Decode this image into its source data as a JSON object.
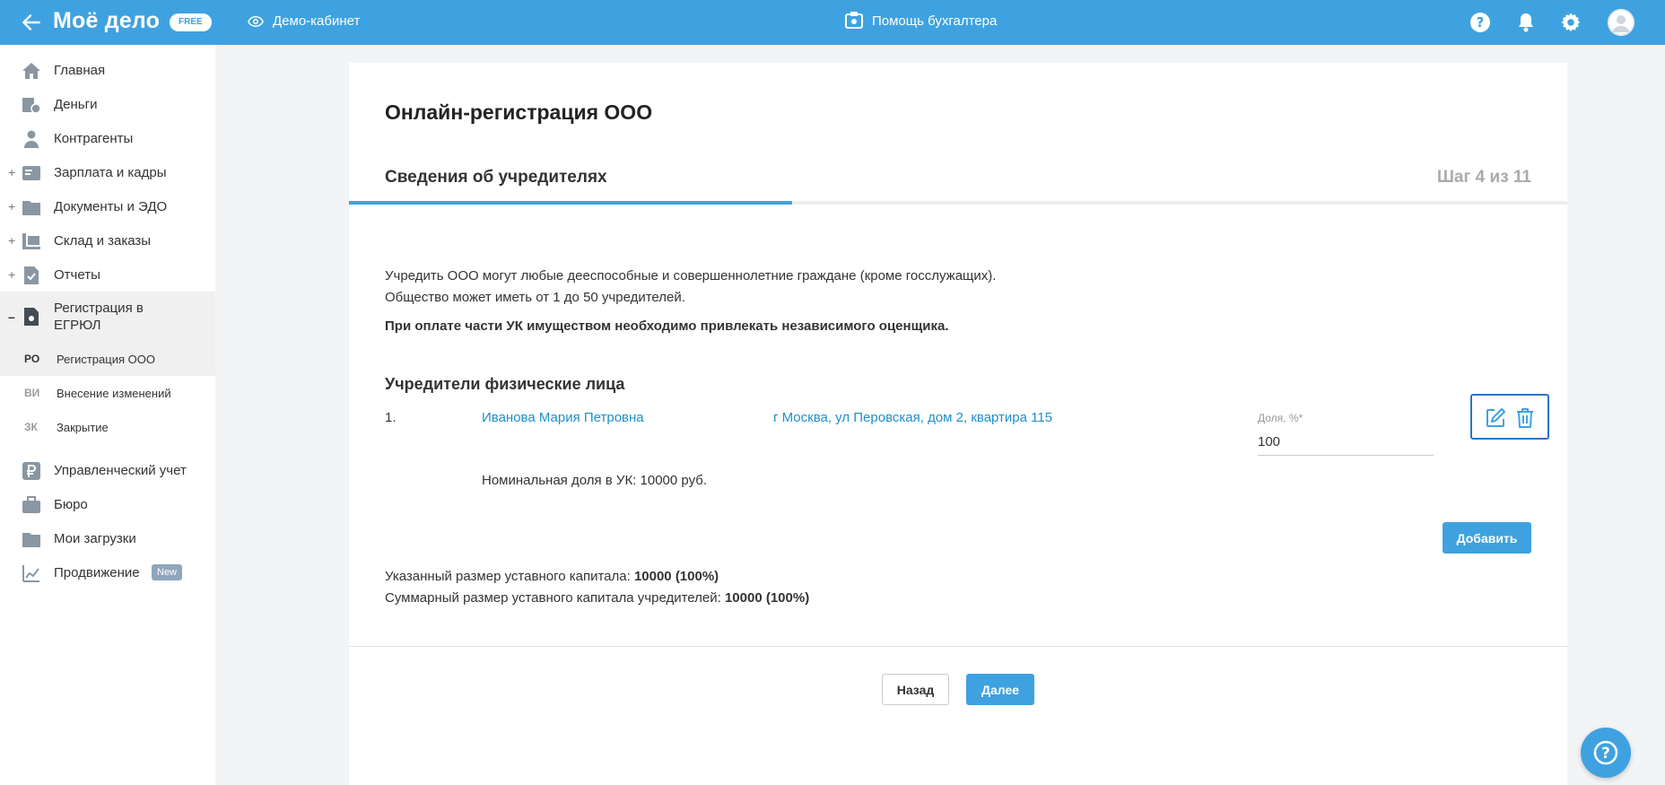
{
  "header": {
    "logo": "Моё дело",
    "badge": "FREE",
    "demo_label": "Демо-кабинет",
    "helper_label": "Помощь бухгалтера"
  },
  "sidebar": {
    "items": [
      {
        "label": "Главная",
        "icon": "home-icon"
      },
      {
        "label": "Деньги",
        "icon": "money-icon"
      },
      {
        "label": "Контрагенты",
        "icon": "contractors-icon"
      },
      {
        "label": "Зарплата и кадры",
        "icon": "salary-icon",
        "expand": "+"
      },
      {
        "label": "Документы и ЭДО",
        "icon": "documents-icon",
        "expand": "+"
      },
      {
        "label": "Склад и заказы",
        "icon": "warehouse-icon",
        "expand": "+"
      },
      {
        "label": "Отчеты",
        "icon": "reports-icon",
        "expand": "+"
      },
      {
        "label": "Регистрация в ЕГРЮЛ",
        "icon": "registration-icon",
        "expand": "–"
      },
      {
        "label": "Управленческий учет",
        "icon": "ruble-icon"
      },
      {
        "label": "Бюро",
        "icon": "briefcase-icon"
      },
      {
        "label": "Мои загрузки",
        "icon": "folder-icon"
      },
      {
        "label": "Продвижение",
        "icon": "chart-icon",
        "badge": "New"
      }
    ],
    "sub_items": [
      {
        "abbr": "РО",
        "label": "Регистрация ООО"
      },
      {
        "abbr": "ВИ",
        "label": "Внесение изменений"
      },
      {
        "abbr": "ЗК",
        "label": "Закрытие"
      }
    ]
  },
  "main": {
    "title": "Онлайн-регистрация ООО",
    "step_name": "Сведения об учредителях",
    "step_count": "Шаг 4 из 11",
    "progress": 0.364,
    "info_line1": "Учредить ООО могут любые дееспособные и совершеннолетние граждане (кроме госслужащих).",
    "info_line2": "Общество может иметь от 1 до 50 учредителей.",
    "info_bold": "При оплате части УК имуществом необходимо привлекать независимого оценщика.",
    "section_title": "Учредители физические лица",
    "founder": {
      "index": "1.",
      "name": "Иванова Мария Петровна",
      "address": "г Москва, ул Перовская, дом 2, квартира 115",
      "share_label": "Доля, %*",
      "share_value": "100",
      "nominal": "Номинальная доля в УК: 10000 руб."
    },
    "add_button": "Добавить",
    "capital_label": "Указанный размер уставного капитала: ",
    "capital_value": "10000 (100%)",
    "total_label": "Суммарный размер уставного капитала учредителей: ",
    "total_value": "10000 (100%)",
    "back_button": "Назад",
    "next_button": "Далее"
  },
  "colors": {
    "brand": "#3fa2e0",
    "link": "#1f8fc9",
    "focus": "#2a73c6"
  }
}
